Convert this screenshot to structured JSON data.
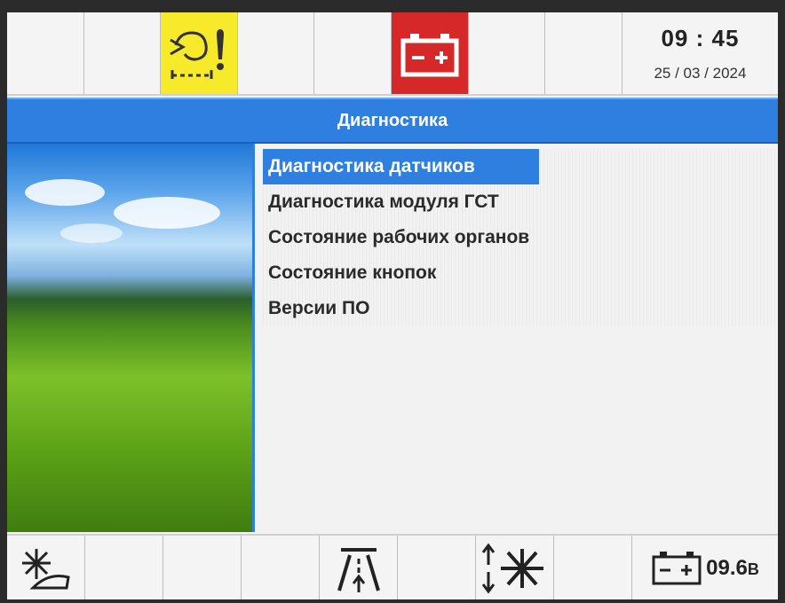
{
  "status": {
    "time": "09 : 45",
    "date": "25 / 03 / 2024",
    "warning_icon": "engine-temperature-warning-icon",
    "battery_icon": "battery-alert-icon"
  },
  "title": "Диагностика",
  "menu": {
    "items": [
      {
        "label": "Диагностика датчиков",
        "selected": true
      },
      {
        "label": "Диагностика модуля ГСТ",
        "selected": false
      },
      {
        "label": "Состояние рабочих органов",
        "selected": false
      },
      {
        "label": "Состояние кнопок",
        "selected": false
      },
      {
        "label": "Версии ПО",
        "selected": false
      }
    ]
  },
  "bottom": {
    "voltage": "09.6",
    "voltage_unit": "В"
  },
  "colors": {
    "accent": "#2f7fe0",
    "warning": "#f7ea2b",
    "alert": "#d62828"
  }
}
